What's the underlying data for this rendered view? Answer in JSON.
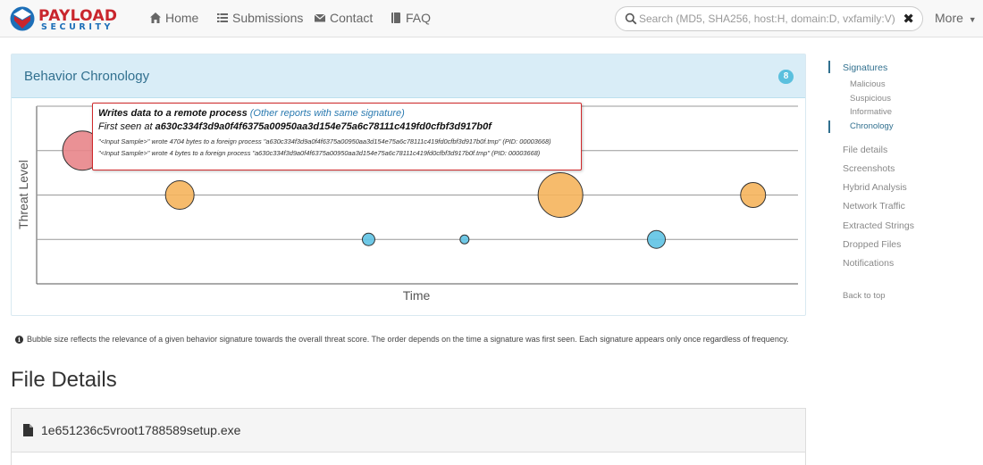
{
  "brand": {
    "word1": "PAYLOAD",
    "word2": "SECURITY"
  },
  "nav": {
    "home": "Home",
    "submissions": "Submissions",
    "contact": "Contact",
    "faq": "FAQ",
    "more": "More"
  },
  "search": {
    "placeholder": "Search (MD5, SHA256, host:H, domain:D, vxfamily:V) ...",
    "value": ""
  },
  "behavior": {
    "title": "Behavior Chronology",
    "badge": "8",
    "y_label": "Threat Level",
    "x_label": "Time"
  },
  "tooltip": {
    "title": "Writes data to a remote process",
    "link": "Other reports with same signature",
    "first_seen_label": "First seen at",
    "first_seen_value": "a630c334f3d9a0f4f6375a00950aa3d154e75a6c78111c419fd0cfbf3d917b0f",
    "line1": "\"<Input Sample>\" wrote 4704 bytes to a foreign process \"a630c334f3d9a0f4f6375a00950aa3d154e75a6c78111c419fd0cfbf3d917b0f.tmp\" (PID: 00003668)",
    "line2": "\"<Input Sample>\" wrote 4 bytes to a foreign process \"a630c334f3d9a0f4f6375a00950aa3d154e75a6c78111c419fd0cfbf3d917b0f.tmp\" (PID: 00003668)"
  },
  "chart_data": {
    "type": "scatter",
    "title": "",
    "xlabel": "Time",
    "ylabel": "Threat Level",
    "grid": true,
    "xlim": [
      0,
      100
    ],
    "ylim": [
      0,
      4
    ],
    "points": [
      {
        "x": 6.0,
        "y": 3,
        "size": 22,
        "level": "malicious"
      },
      {
        "x": 18.8,
        "y": 2,
        "size": 16,
        "level": "suspicious"
      },
      {
        "x": 43.6,
        "y": 1,
        "size": 7,
        "level": "informative"
      },
      {
        "x": 56.2,
        "y": 1,
        "size": 5,
        "level": "informative"
      },
      {
        "x": 68.8,
        "y": 2,
        "size": 25,
        "level": "suspicious"
      },
      {
        "x": 81.4,
        "y": 1,
        "size": 10,
        "level": "informative"
      },
      {
        "x": 94.1,
        "y": 2,
        "size": 14,
        "level": "suspicious"
      }
    ],
    "colors": {
      "malicious": "#e8858a",
      "suspicious": "#f5b45c",
      "informative": "#5fc3e4",
      "stroke": "#333333"
    }
  },
  "note": "Bubble size reflects the relevance of a given behavior signature towards the overall threat score. The order depends on the time a signature was first seen. Each signature appears only once regardless of frequency.",
  "file_details": {
    "heading": "File Details",
    "filename": "1e651236c5vroot1788589setup.exe"
  },
  "sidebar": {
    "signatures": "Signatures",
    "malicious": "Malicious",
    "suspicious": "Suspicious",
    "informative": "Informative",
    "chronology": "Chronology",
    "file_details": "File details",
    "screenshots": "Screenshots",
    "hybrid_analysis": "Hybrid Analysis",
    "network_traffic": "Network Traffic",
    "extracted_strings": "Extracted Strings",
    "dropped_files": "Dropped Files",
    "notifications": "Notifications",
    "back_to_top": "Back to top"
  }
}
